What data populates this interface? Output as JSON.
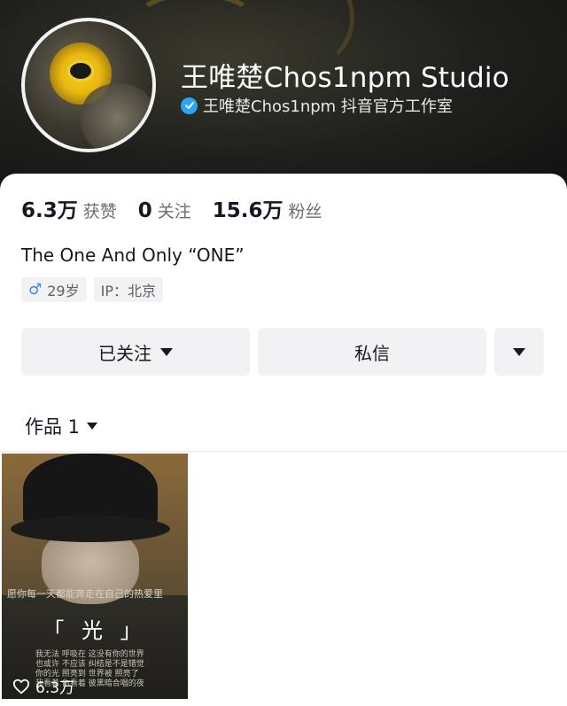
{
  "profile": {
    "name": "王唯楚Chos1npm Studio",
    "verify_text": "王唯楚Chos1npm 抖音官方工作室",
    "verified_icon": "verified-check-icon",
    "accent_color": "#2aa4f4"
  },
  "stats": [
    {
      "value": "6.3万",
      "label": "获赞"
    },
    {
      "value": "0",
      "label": "关注"
    },
    {
      "value": "15.6万",
      "label": "粉丝"
    }
  ],
  "bio": "The One And Only “ONE”",
  "tags": {
    "gender_icon": "♂",
    "age": "29岁",
    "ip": "IP：北京"
  },
  "actions": {
    "follow_label": "已关注",
    "message_label": "私信"
  },
  "works": {
    "label": "作品 1"
  },
  "video": {
    "caption": "愿你每一天都能奔走在自己的热爱里",
    "title": "「 光 」",
    "lyric_lines": [
      "我无法 呼吸在 这没有你的世界",
      "也或许 不应该 纠结是不是错觉",
      "你的光 照亮到 世界被 照亮了",
      "我看着 你看着 彼黑暗合唱的夜"
    ],
    "likes": "6.3万"
  }
}
